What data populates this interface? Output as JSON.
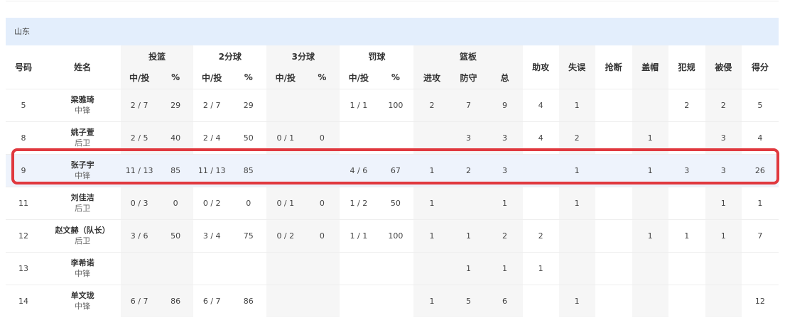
{
  "team": "山东",
  "headers": {
    "number": "号码",
    "name": "姓名",
    "fg": "投篮",
    "two": "2分球",
    "three": "3分球",
    "ft": "罚球",
    "reb": "篮板",
    "made_att": "中/投",
    "pct": "%",
    "off": "进攻",
    "def": "防守",
    "tot": "总",
    "ast": "助攻",
    "tov": "失误",
    "stl": "抢断",
    "blk": "盖帽",
    "pf": "犯规",
    "fd": "被侵",
    "pts": "得分"
  },
  "rows": [
    [
      "5",
      "梁雅琦",
      "中锋",
      "2 / 7",
      "29",
      "2 / 7",
      "29",
      "",
      "",
      "1 / 1",
      "100",
      "2",
      "7",
      "9",
      "4",
      "1",
      "",
      "",
      "2",
      "2",
      "5"
    ],
    [
      "8",
      "姚子萱",
      "后卫",
      "2 / 5",
      "40",
      "2 / 4",
      "50",
      "0 / 1",
      "0",
      "",
      "",
      "",
      "3",
      "3",
      "4",
      "2",
      "",
      "1",
      "",
      "3",
      "4"
    ],
    [
      "9",
      "张子宇",
      "中锋",
      "11 / 13",
      "85",
      "11 / 13",
      "85",
      "",
      "",
      "4 / 6",
      "67",
      "1",
      "2",
      "3",
      "",
      "1",
      "",
      "1",
      "3",
      "3",
      "26"
    ],
    [
      "11",
      "刘佳洁",
      "后卫",
      "0 / 3",
      "0",
      "0 / 2",
      "0",
      "0 / 1",
      "0",
      "1 / 2",
      "50",
      "1",
      "",
      "1",
      "",
      "1",
      "",
      "",
      "",
      "1",
      "1"
    ],
    [
      "12",
      "赵文赫（队长）",
      "后卫",
      "3 / 6",
      "50",
      "3 / 4",
      "75",
      "0 / 2",
      "0",
      "1 / 1",
      "100",
      "1",
      "1",
      "2",
      "2",
      "",
      "",
      "1",
      "1",
      "1",
      "7"
    ],
    [
      "13",
      "李希诺",
      "中锋",
      "",
      "",
      "",
      "",
      "",
      "",
      "",
      "",
      "",
      "1",
      "1",
      "1",
      "",
      "",
      "",
      "",
      "",
      ""
    ],
    [
      "14",
      "单文珑",
      "中锋",
      "6 / 7",
      "86",
      "6 / 7",
      "86",
      "",
      "",
      "",
      "",
      "1",
      "5",
      "6",
      "",
      "1",
      "",
      "",
      "",
      "",
      "12"
    ]
  ],
  "highlighted_player": "张子宇"
}
